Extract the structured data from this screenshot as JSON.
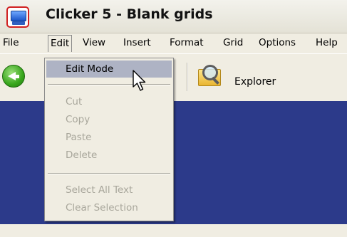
{
  "window": {
    "title": "Clicker 5 - Blank grids"
  },
  "menu": [
    {
      "label": "File"
    },
    {
      "label": "Edit"
    },
    {
      "label": "View"
    },
    {
      "label": "Insert"
    },
    {
      "label": "Format"
    },
    {
      "label": "Grid"
    },
    {
      "label": "Options"
    },
    {
      "label": "Help"
    }
  ],
  "toolbar": {
    "explorer_label": "Explorer"
  },
  "edit_menu": {
    "items": [
      {
        "label": "Edit Mode",
        "enabled": true,
        "highlighted": true
      },
      {
        "label": "Cut",
        "enabled": false
      },
      {
        "label": "Copy",
        "enabled": false
      },
      {
        "label": "Paste",
        "enabled": false
      },
      {
        "label": "Delete",
        "enabled": false
      },
      {
        "label": "Select All Text",
        "enabled": false
      },
      {
        "label": "Clear Selection",
        "enabled": false
      }
    ]
  },
  "colors": {
    "content_bg": "#2c3a8a",
    "highlight": "#aeb3c4",
    "disabled_text": "#a8a69b"
  }
}
